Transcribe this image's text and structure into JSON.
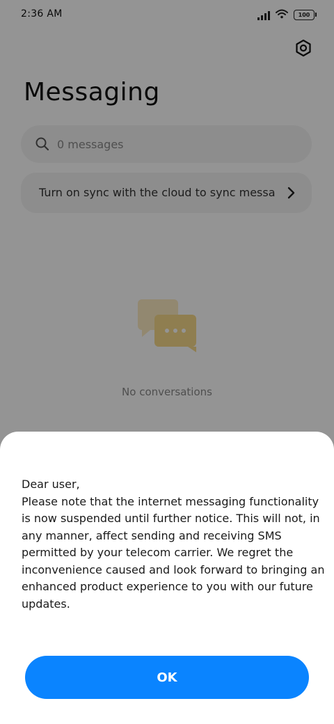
{
  "status_bar": {
    "time": "2:36 AM",
    "battery": "100"
  },
  "header": {
    "title": "Messaging",
    "settings_icon": "gear-icon"
  },
  "search": {
    "placeholder": "0 messages",
    "value": "",
    "icon": "search-icon"
  },
  "sync_banner": {
    "text": "Turn on sync with the cloud to sync messages",
    "icon": "chevron-right-icon"
  },
  "empty_state": {
    "text": "No conversations",
    "icon": "chat-bubbles-icon"
  },
  "dialog": {
    "message": "Dear user,\nPlease note that the internet messaging functionality is now suspended until further notice. This will not, in any manner, affect sending and receiving SMS permitted by your telecom carrier. We regret the inconvenience caused and look forward to bringing an enhanced product experience to you with our future updates.",
    "ok_label": "OK"
  },
  "colors": {
    "accent": "#0a84ff",
    "illustration": "#f6d98a",
    "illustration_light": "#fbeac2"
  }
}
